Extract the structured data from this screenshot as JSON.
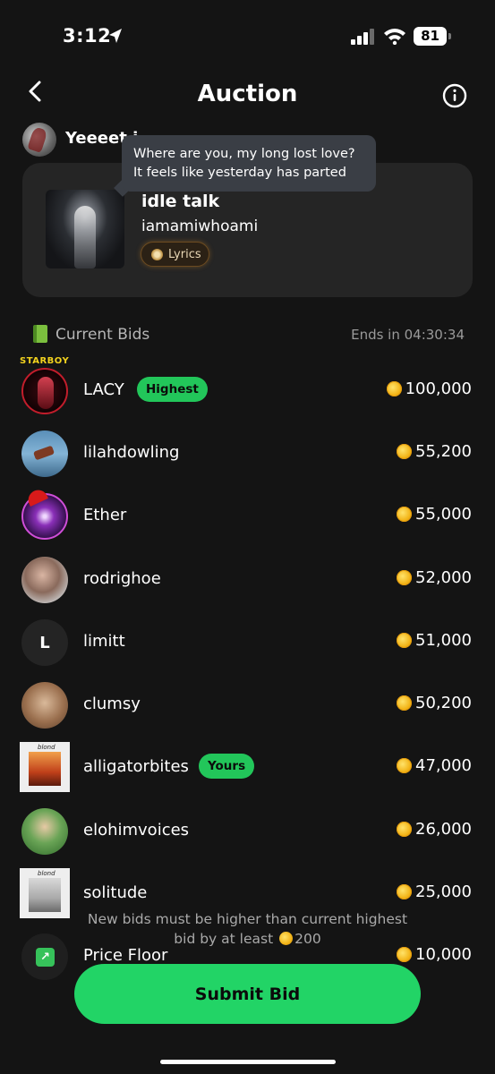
{
  "status_bar": {
    "time": "3:12",
    "battery": "81"
  },
  "header": {
    "title": "Auction"
  },
  "host": {
    "text": "Yeeeet i"
  },
  "tooltip": {
    "line1": "Where are you, my long lost love?",
    "line2": "It feels like yesterday has parted"
  },
  "song": {
    "title": "idle talk",
    "artist": "iamamiwhoami",
    "lyrics_label": "Lyrics"
  },
  "bids": {
    "section_title": "Current Bids",
    "ends_in": "Ends in 04:30:34",
    "rows": [
      {
        "name": "LACY",
        "badge": "Highest",
        "amount": "100,000",
        "avatar_label": "STARBOY"
      },
      {
        "name": "lilahdowling",
        "amount": "55,200"
      },
      {
        "name": "Ether",
        "amount": "55,000"
      },
      {
        "name": "rodrighoe",
        "amount": "52,000"
      },
      {
        "name": "limitt",
        "amount": "51,000",
        "avatar_letter": "L"
      },
      {
        "name": "clumsy",
        "amount": "50,200"
      },
      {
        "name": "alligatorbites",
        "badge": "Yours",
        "amount": "47,000"
      },
      {
        "name": "elohimvoices",
        "amount": "26,000"
      },
      {
        "name": "solitude",
        "amount": "25,000"
      },
      {
        "name": "Price Floor",
        "amount": "10,000"
      }
    ]
  },
  "notice": {
    "line1": "New bids must be higher than current highest",
    "line2_prefix": "bid by at least",
    "line2_amount": "200"
  },
  "submit": {
    "label": "Submit Bid"
  },
  "colors": {
    "accent": "#22d466",
    "background": "#141414",
    "card": "#252525",
    "tooltip": "#3a3e45"
  }
}
